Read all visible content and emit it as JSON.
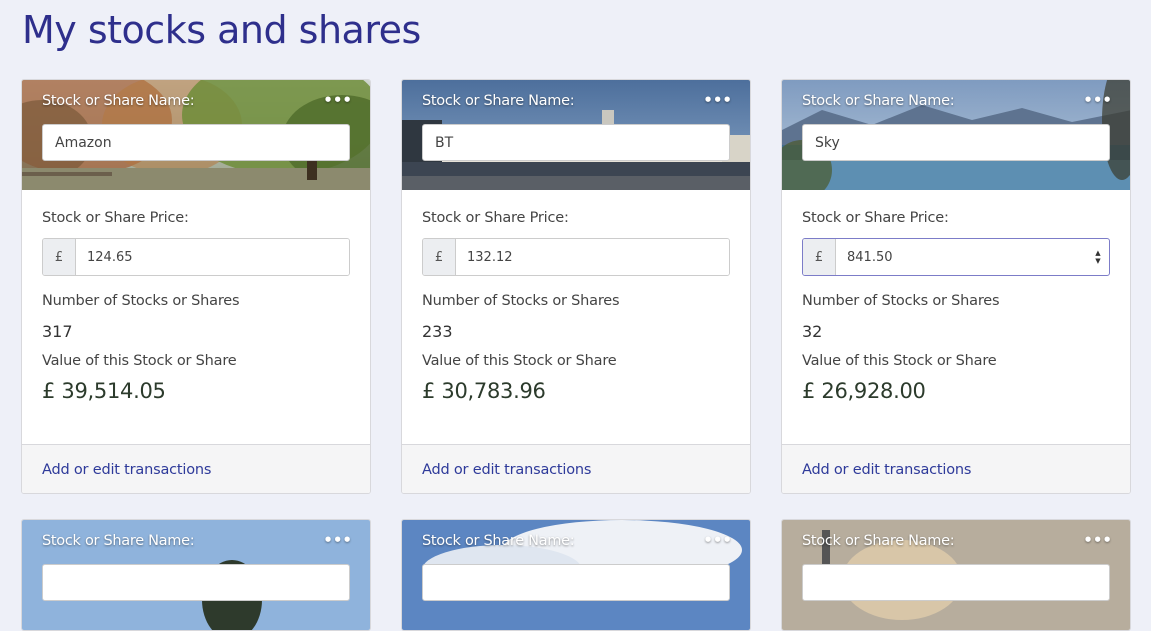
{
  "page": {
    "title": "My stocks and shares"
  },
  "cards": [
    {
      "header_label": "Stock or Share Name:",
      "name": "Amazon",
      "price_label": "Stock or Share Price:",
      "currency": "£",
      "price": "124.65",
      "count_label": "Number of Stocks or Shares",
      "count": "317",
      "value_label": "Value of this Stock or Share",
      "value": "£ 39,514.05",
      "footer_link": "Add or edit transactions"
    },
    {
      "header_label": "Stock or Share Name:",
      "name": "BT",
      "price_label": "Stock or Share Price:",
      "currency": "£",
      "price": "132.12",
      "count_label": "Number of Stocks or Shares",
      "count": "233",
      "value_label": "Value of this Stock or Share",
      "value": "£ 30,783.96",
      "footer_link": "Add or edit transactions"
    },
    {
      "header_label": "Stock or Share Name:",
      "name": "Sky",
      "price_label": "Stock or Share Price:",
      "currency": "£",
      "price": "841.50",
      "count_label": "Number of Stocks or Shares",
      "count": "32",
      "value_label": "Value of this Stock or Share",
      "value": "£ 26,928.00",
      "footer_link": "Add or edit transactions"
    },
    {
      "header_label": "Stock or Share Name:"
    },
    {
      "header_label": "Stock or Share Name:"
    },
    {
      "header_label": "Stock or Share Name:"
    }
  ],
  "icons": {
    "card_menu": "more-horizontal-icon"
  }
}
